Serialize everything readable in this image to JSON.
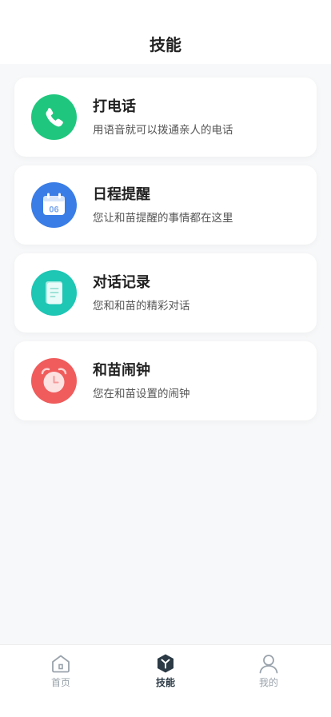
{
  "header": {
    "title": "技能"
  },
  "skills": [
    {
      "title": "打电话",
      "desc": "用语音就可以拨通亲人的电话",
      "icon": "phone-icon",
      "color": "#1fc77e"
    },
    {
      "title": "日程提醒",
      "desc": "您让和苗提醒的事情都在这里",
      "icon": "calendar-icon",
      "color": "#3a7de6",
      "icon_text": "06"
    },
    {
      "title": "对话记录",
      "desc": "您和和苗的精彩对话",
      "icon": "notes-icon",
      "color": "#1ec6b4"
    },
    {
      "title": "和苗闹钟",
      "desc": "您在和苗设置的闹钟",
      "icon": "alarm-clock-icon",
      "color": "#f05c5c"
    }
  ],
  "tabbar": {
    "home_label": "首页",
    "skills_label": "技能",
    "mine_label": "我的",
    "active": "skills",
    "active_color": "#2b3a45",
    "inactive_color": "#9aa3ab"
  }
}
